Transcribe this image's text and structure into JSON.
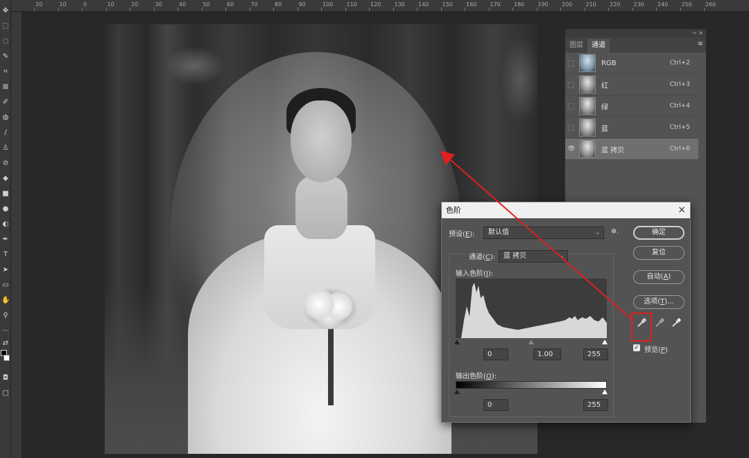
{
  "ruler": {
    "ticks": [
      "20",
      "10",
      "0",
      "10",
      "20",
      "30",
      "40",
      "50",
      "60",
      "70",
      "80",
      "90",
      "100",
      "110",
      "120",
      "130",
      "140",
      "150",
      "160",
      "170",
      "180",
      "190",
      "200",
      "210",
      "220",
      "230",
      "240",
      "250",
      "260"
    ]
  },
  "channels_panel": {
    "top_icons": "‹‹ ×",
    "tabs": [
      {
        "label": "图层",
        "active": false
      },
      {
        "label": "通道",
        "active": true
      }
    ],
    "menu_icon": "≡",
    "channels": [
      {
        "name": "RGB",
        "shortcut": "Ctrl+2",
        "visible": false,
        "selected": false,
        "thumb": "rgb"
      },
      {
        "name": "红",
        "shortcut": "Ctrl+3",
        "visible": false,
        "selected": false,
        "thumb": "gray"
      },
      {
        "name": "绿",
        "shortcut": "Ctrl+4",
        "visible": false,
        "selected": false,
        "thumb": "gray"
      },
      {
        "name": "蓝",
        "shortcut": "Ctrl+5",
        "visible": false,
        "selected": false,
        "thumb": "gray"
      },
      {
        "name": "蓝 拷贝",
        "shortcut": "Ctrl+6",
        "visible": true,
        "selected": true,
        "thumb": "gray"
      }
    ]
  },
  "levels_dialog": {
    "title": "色阶",
    "close": "×",
    "preset_label": "预设(",
    "preset_key": "E",
    "preset_suffix": "):",
    "preset_value": "默认值",
    "gear": "✲.",
    "channel_label": "通道(",
    "channel_key": "C",
    "channel_suffix": "):",
    "channel_value": "蓝 拷贝",
    "input_label": "输入色阶(",
    "input_key": "I",
    "input_suffix": "):",
    "input_black": "0",
    "input_gamma": "1.00",
    "input_white": "255",
    "output_label": "输出色阶(",
    "output_key": "O",
    "output_suffix": "):",
    "output_black": "0",
    "output_white": "255",
    "buttons": {
      "ok": "确定",
      "reset": "复位",
      "auto_prefix": "自动(",
      "auto_key": "A",
      "auto_suffix": ")",
      "options_prefix": "选项(",
      "options_key": "T",
      "options_suffix": ")..."
    },
    "preview_prefix": "预览(",
    "preview_key": "P",
    "preview_suffix": ")",
    "preview_checked": true,
    "droppers": [
      "black-point-eyedropper",
      "gray-point-eyedropper",
      "white-point-eyedropper"
    ],
    "highlight_color": "#e02020"
  },
  "annotation": {
    "arrow_color": "#e02020"
  }
}
